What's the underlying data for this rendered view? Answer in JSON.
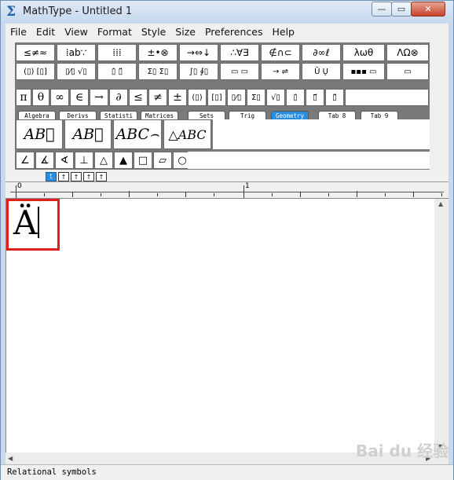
{
  "window": {
    "title": "MathType - Untitled 1",
    "app_icon": "Σ",
    "controls": {
      "minimize": "—",
      "maximize": "▭",
      "close": "✕"
    }
  },
  "menu": [
    "File",
    "Edit",
    "View",
    "Format",
    "Style",
    "Size",
    "Preferences",
    "Help"
  ],
  "palette_row1": [
    "≤≠≈",
    "⁞ab∵",
    "⁞⁞⁞",
    "±•⊗",
    "→⇔↓",
    "∴∀∃",
    "∉∩⊂",
    "∂∞ℓ",
    "λωθ",
    "ΛΩ⊗"
  ],
  "palette_row2": [
    "(▯) [▯]",
    "▯⁄▯ √▯",
    "▯̇ ▯̈",
    "Σ▯ Σ▯",
    "∫▯ ∮▯",
    "▭ ▭",
    "→ ⇌",
    "Ū Ų",
    "▪▪▪ ▭",
    "▭"
  ],
  "symbol_row": [
    "π",
    "θ",
    "∞",
    "∈",
    "→",
    "∂",
    "≤",
    "≠",
    "±",
    "(▯)",
    "[▯]",
    "▯⁄▯",
    "Σ▯",
    "√▯",
    "▯̇",
    "▯⃗",
    "▯̃"
  ],
  "tabs": [
    "Algebra",
    "Derivs",
    "Statisti",
    "Matrices",
    "Sets",
    "Trig",
    "Geometry",
    "Tab 8",
    "Tab 9"
  ],
  "active_tab": "Geometry",
  "templates": [
    "AB⃗",
    "AB⃡",
    "ABC⌢",
    "△ABC"
  ],
  "geometry_symbols": [
    "∠",
    "∡",
    "∢",
    "⊥",
    "△",
    "▲",
    "□",
    "▱",
    "○"
  ],
  "tab_stops": [
    "⮤",
    "↑",
    "↑",
    "↑",
    "↑"
  ],
  "ruler": {
    "labels": [
      "0",
      "1"
    ]
  },
  "equation": {
    "text": "Ä"
  },
  "watermark": "Bai du 经验",
  "status": {
    "text": "Relational symbols"
  }
}
